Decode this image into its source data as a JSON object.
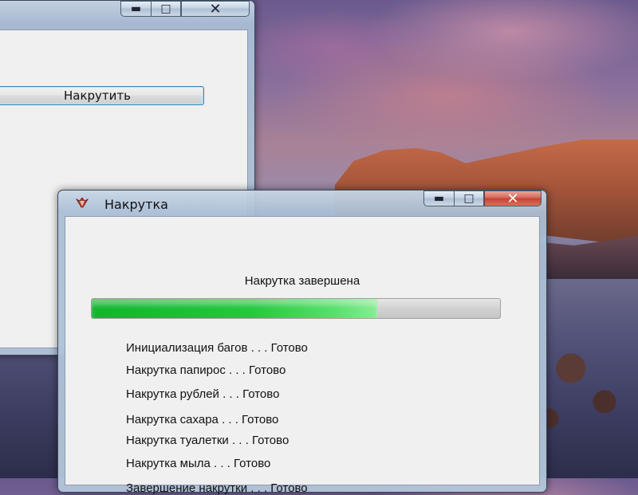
{
  "background": {
    "description_colors": {
      "sky": "#8c7aa0",
      "rocks": "#b4603f",
      "sea": "#3e3f63"
    }
  },
  "main_window": {
    "button_label": "Накрутить",
    "controls": {
      "minimize": "minimize-icon",
      "maximize": "maximize-icon",
      "close": "close-icon"
    }
  },
  "dialog": {
    "title": "Накрутка",
    "icon": "app-icon",
    "status_text": "Накрутка завершена",
    "progress_fraction": 0.7,
    "log": [
      "Инициализация багов . . . Готово",
      "Накрутка папирос . . . Готово",
      "Накрутка рублей . . . Готово",
      "Накрутка сахара . . . Готово",
      "Накрутка туалетки . . . Готово",
      "Накрутка мыла . . . Готово",
      "Завершение накрутки . . . Готово"
    ],
    "colors": {
      "progress": "#22c83e",
      "close_button": "#c44431"
    }
  }
}
